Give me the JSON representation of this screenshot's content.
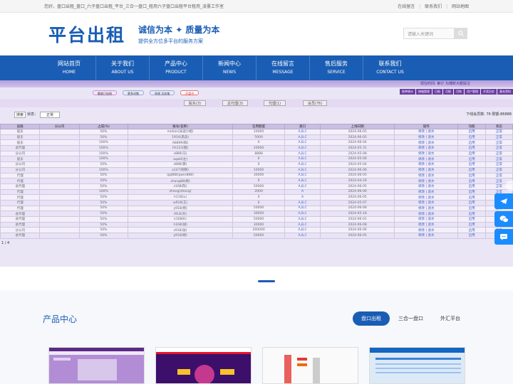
{
  "topbar": {
    "welcome": "您好，盘口出租_盘口_六子盘口出租_平台_三合一盘口_租用六子盘口出租平台租用_凌薹工作室",
    "links": [
      "在线留言",
      "联系我们",
      "网站地图"
    ]
  },
  "header": {
    "logo": "平台出租",
    "slogan_main": "诚信为本 ✦ 质量为本",
    "slogan_sub": "提供全方位多平台的服务方案",
    "search_placeholder": "请输入关键词"
  },
  "nav": [
    {
      "cn": "网站首页",
      "en": "HOME"
    },
    {
      "cn": "关于我们",
      "en": "ABOUT US"
    },
    {
      "cn": "产品中心",
      "en": "PRODUCT"
    },
    {
      "cn": "新闻中心",
      "en": "NEWS"
    },
    {
      "cn": "在线留言",
      "en": "MESSAGE"
    },
    {
      "cn": "售后服务",
      "en": "SERVICE"
    },
    {
      "cn": "联系我们",
      "en": "CONTACT US"
    }
  ],
  "screenshot": {
    "marquee": "现在时间: 审订 为博财大额投注",
    "pills": [
      "额度已连接",
      "更多详细",
      "系统 法务推",
      "开盘中"
    ],
    "tabs": [
      "各种统计",
      "统幅管理",
      "日报",
      "月报",
      "月帐",
      "用户管理",
      "开奖历史",
      "基本资料"
    ],
    "filters": [
      "股东(3)",
      "总代理(3)",
      "代理(1)",
      "会员(76)"
    ],
    "query_label": "搜索",
    "state_label": "状态：",
    "state_value": "正常",
    "count_text": "下线会员数: 76 限额:86888",
    "columns": [
      "层级",
      "分公司",
      "占成(%)",
      "账号(名称)",
      "信用额度",
      "盘口",
      "上线日期",
      "操作",
      "功能",
      "状态"
    ],
    "rows": [
      [
        "股东",
        "50%",
        "midian(米迪小姐)",
        "10000",
        "A,B,C",
        "2024-06-05",
        "修改 | 退水",
        "启用",
        "正常"
      ],
      [
        "股东",
        "50%",
        "1914(黑蒜)",
        "5000",
        "A,B,C",
        "2024-06-05",
        "修改 | 退水",
        "启用",
        "正常"
      ],
      [
        "股东",
        "100%",
        "A8899(鲜)",
        "0",
        "A,B,C",
        "2024-06-04",
        "修改 | 退水",
        "启用",
        "正常"
      ],
      [
        "总代理",
        "100%",
        "hh123(魅)",
        "20000",
        "A,B,C",
        "2024-05-31",
        "修改 | 退水",
        "启用",
        "正常"
      ],
      [
        "分公司",
        "100%",
        "s888(马)",
        "8888",
        "A,B,C",
        "2024-05-08",
        "修改 | 退水",
        "启用",
        "正常"
      ],
      [
        "股东",
        "100%",
        "aqw0(左)",
        "0",
        "A,B,C",
        "2024-05-06",
        "修改 | 退水",
        "启用",
        "正常"
      ],
      [
        "分公司",
        "50%",
        "z888(黄)",
        "0",
        "A,B,C",
        "2024-05-04",
        "修改 | 退水",
        "启用",
        "正常"
      ],
      [
        "分公司",
        "100%",
        "a147(啊啊)",
        "10000",
        "A,B,C",
        "2024-06-06",
        "修改 | 退水",
        "启用",
        "正常"
      ],
      [
        "代理",
        "50%",
        "qq888(qwer888)",
        "30000",
        "A,B,C",
        "2024-06-05",
        "修改 | 退水",
        "启用",
        "正常"
      ],
      [
        "代理",
        "50%",
        "zhang88(刷)",
        "0",
        "A,B,C",
        "2024-04-29",
        "修改 | 退水",
        "启用",
        "正常"
      ],
      [
        "总代理",
        "50%",
        "z168(陈)",
        "50000",
        "A,B,C",
        "2024-06-05",
        "修改 | 退水",
        "启用",
        "正常"
      ],
      [
        "代理",
        "100%",
        "zhang(zhang)",
        "2000",
        "A",
        "2024-06-06",
        "修改 | 退水",
        "启用",
        "正常"
      ],
      [
        "代理",
        "50%",
        "h118(u)",
        "0",
        "A",
        "2024-06-05",
        "修改 | 退水",
        "启用",
        "正常"
      ],
      [
        "代理",
        "50%",
        "w918(王)",
        "0",
        "A,B,C",
        "2024-05-07",
        "修改 | 退水",
        "启用",
        "正常"
      ],
      [
        "代理",
        "50%",
        "y918(杨)",
        "50000",
        "A,B,C",
        "2024-06-06",
        "修改 | 退水",
        "启用",
        "正常"
      ],
      [
        "总代理",
        "50%",
        "l918(刘)",
        "30000",
        "A,B,C",
        "2024-05-18",
        "修改 | 退水",
        "启用",
        "正常"
      ],
      [
        "总代理",
        "50%",
        "k168(K)",
        "50000",
        "A,B,C",
        "2024-06-01",
        "修改 | 退水",
        "启用",
        "正常"
      ],
      [
        "总代理",
        "50%",
        "h168(胡)",
        "30000",
        "A,B,C",
        "2024-06-08",
        "修改 | 退水",
        "启用",
        "正常"
      ],
      [
        "分公司",
        "50%",
        "z918(张)",
        "200000",
        "A,B,C",
        "2024-06-06",
        "修改 | 退水",
        "启用",
        "正常"
      ],
      [
        "总代理",
        "50%",
        "y918(杨)",
        "50000",
        "A,B,C",
        "2024-06-05",
        "修改 | 退水",
        "启用",
        "正常"
      ]
    ],
    "pager": "1 / 4"
  },
  "products": {
    "title": "产品中心",
    "tabs": [
      "盘口出租",
      "三合一盘口",
      "外汇平台"
    ]
  },
  "colors": {
    "brand": "#1a5db4",
    "accent": "#1a8cff",
    "panel": "#eae6f6"
  }
}
